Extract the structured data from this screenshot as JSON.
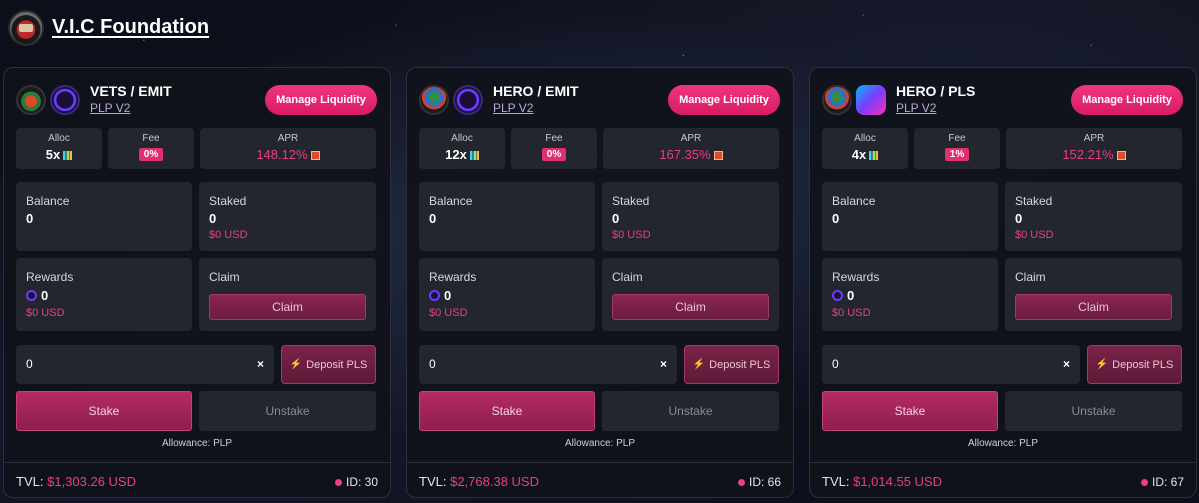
{
  "brand": {
    "title": "V.I.C Foundation"
  },
  "common": {
    "manage": "Manage Liquidity",
    "alloc": "Alloc",
    "fee": "Fee",
    "apr": "APR",
    "balance": "Balance",
    "staked": "Staked",
    "rewards": "Rewards",
    "claim_label": "Claim",
    "claim_button": "Claim",
    "deposit": "Deposit PLS",
    "stake": "Stake",
    "unstake": "Unstake",
    "allowance": "Allowance: PLP",
    "tvl_label": "TVL:",
    "clear": "×"
  },
  "pools": [
    {
      "pair": "VETS / EMIT",
      "version": "PLP V2",
      "alloc": "5x",
      "fee": "0%",
      "apr": "148.12%",
      "balance": "0",
      "staked": "0",
      "staked_usd": "$0 USD",
      "rewards": "0",
      "rewards_usd": "$0 USD",
      "amount": "0",
      "tvl": "$1,303.26 USD",
      "id": "ID: 30",
      "icons": [
        "vets-token-icon",
        "emit-token-icon"
      ]
    },
    {
      "pair": "HERO / EMIT",
      "version": "PLP V2",
      "alloc": "12x",
      "fee": "0%",
      "apr": "167.35%",
      "balance": "0",
      "staked": "0",
      "staked_usd": "$0 USD",
      "rewards": "0",
      "rewards_usd": "$0 USD",
      "amount": "0",
      "tvl": "$2,768.38 USD",
      "id": "ID: 66",
      "icons": [
        "hero-token-icon",
        "emit-token-icon"
      ]
    },
    {
      "pair": "HERO / PLS",
      "version": "PLP V2",
      "alloc": "4x",
      "fee": "1%",
      "apr": "152.21%",
      "balance": "0",
      "staked": "0",
      "staked_usd": "$0 USD",
      "rewards": "0",
      "rewards_usd": "$0 USD",
      "amount": "0",
      "tvl": "$1,014.55 USD",
      "id": "ID: 67",
      "icons": [
        "hero-token-icon",
        "pls-token-icon"
      ]
    }
  ],
  "colors": {
    "accent": "#e8407e",
    "button": "#d81b63",
    "panel": "#23252f"
  }
}
